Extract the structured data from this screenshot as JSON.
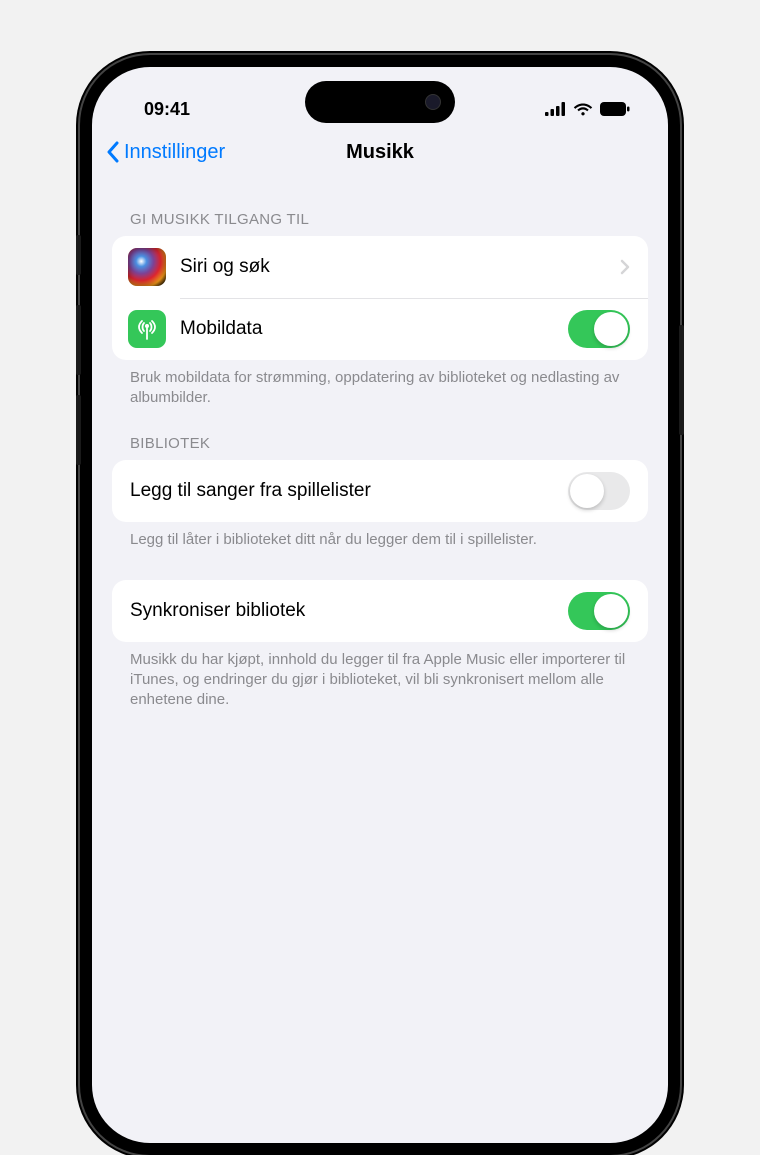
{
  "statusBar": {
    "time": "09:41"
  },
  "nav": {
    "back": "Innstillinger",
    "title": "Musikk"
  },
  "sections": {
    "access": {
      "header": "GI MUSIKK TILGANG TIL",
      "siri": "Siri og søk",
      "cellular": "Mobildata",
      "footer": "Bruk mobildata for strømming, oppdatering av biblioteket og nedlasting av albumbilder."
    },
    "library": {
      "header": "BIBLIOTEK",
      "addSongs": "Legg til sanger fra spillelister",
      "addSongsFooter": "Legg til låter i biblioteket ditt når du legger dem til i spillelister.",
      "syncLibrary": "Synkroniser bibliotek",
      "syncFooter": "Musikk du har kjøpt, innhold du legger til fra Apple Music eller importerer til iTunes, og endringer du gjør i biblioteket, vil bli synkronisert mellom alle enhetene dine."
    }
  }
}
